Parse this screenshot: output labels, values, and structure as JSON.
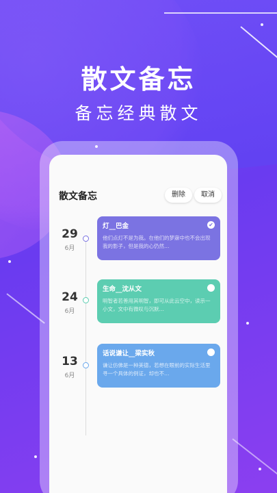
{
  "hero": {
    "title": "散文备忘",
    "subtitle": "备忘经典散文"
  },
  "app": {
    "title": "散文备忘",
    "delete_label": "删除",
    "cancel_label": "取消"
  },
  "entries": [
    {
      "day": "29",
      "month": "6月",
      "title": "灯__巴金",
      "body": "他们点灯不是为我。在他们的梦寐中也不会出现我的影子，但是我的心仍然…",
      "color": "#7b73e2",
      "checked": true,
      "check_icon": "check-icon"
    },
    {
      "day": "24",
      "month": "6月",
      "title": "生命__沈从文",
      "body": "明智者若善用其明智，即可从此云空中，读示一小文，文中有微叹与沉默…",
      "color": "#5ccdb1",
      "checked": false
    },
    {
      "day": "13",
      "month": "6月",
      "title": "话说谦让__梁实秋",
      "body": "谦让仿佛是一种美德，若想在眼前的实际生活里寻一个具体的例证，却也不…",
      "color": "#6aa8ec",
      "checked": false
    }
  ]
}
